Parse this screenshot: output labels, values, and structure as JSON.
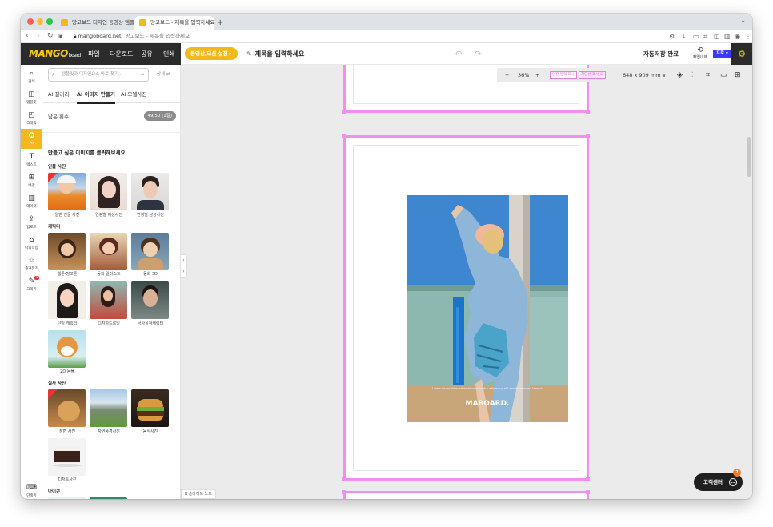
{
  "browser": {
    "tabs": [
      {
        "title": "망고보드 디자인 동영상 템플릿"
      },
      {
        "title": "망고보드 - 제목을 입력하세요"
      }
    ],
    "url": "mangoboard.net",
    "page_title": "망고보드 - 제목을 입력하세요"
  },
  "header": {
    "menu": [
      "파일",
      "다운로드",
      "공유",
      "인쇄"
    ],
    "mode_button": "동영상/모션 설정 ▸",
    "title_placeholder": "제목을 입력하세요",
    "autosave": "자동저장 완료",
    "history_label": "작업내역",
    "pro_label": "프로 ▾"
  },
  "rail": {
    "items": [
      {
        "label": "검색",
        "icon": "search-icon"
      },
      {
        "label": "템플릿",
        "icon": "template-icon"
      },
      {
        "label": "그래픽",
        "icon": "graphic-icon"
      },
      {
        "label": "AI",
        "icon": "ai-icon"
      },
      {
        "label": "텍스트",
        "icon": "text-icon"
      },
      {
        "label": "배경",
        "icon": "background-icon"
      },
      {
        "label": "데이터",
        "icon": "chart-icon"
      },
      {
        "label": "업로드",
        "icon": "upload-icon"
      },
      {
        "label": "나의작업",
        "icon": "folder-icon"
      },
      {
        "label": "즐겨찾기",
        "icon": "star-icon"
      },
      {
        "label": "그리기",
        "icon": "draw-icon"
      }
    ],
    "new_badge": "N",
    "shortcut_label": "단축키"
  },
  "panel": {
    "search_placeholder": "템플릿과 디자인요소 바로 찾기...",
    "detail_link": "상세 ⇄",
    "tabs": [
      "AI 갤러리",
      "AI 이미지 만들기",
      "AI 모델사진"
    ],
    "remain_label": "남은 횟수",
    "remain_value": "49/50 (1일)",
    "prompt": "만들고 싶은 이미지를 클릭해보세요.",
    "sections": {
      "people": {
        "title": "인물 사진",
        "items": [
          "일반 인물 사진",
          "연령별 여성사진",
          "연령별 남성사진"
        ]
      },
      "character": {
        "title": "캐릭터",
        "items": [
          "웹툰-망고툰",
          "동화 일러스트",
          "동화 3D",
          "단일 캐릭터",
          "디지털드로잉",
          "극사실적캐릭터",
          "2D 동물"
        ]
      },
      "real": {
        "title": "실사 사진",
        "items": [
          "장면 사진",
          "자연풍경사진",
          "음식사진",
          "디저트사진"
        ]
      },
      "icon": {
        "title": "아이콘"
      }
    }
  },
  "canvas": {
    "zoom_minus": "−",
    "zoom_value": "36%",
    "zoom_plus": "+",
    "safe_area": "안전 영역 표시",
    "print_line": "재단선 표시",
    "page_size": "648 x 909 mm ∨",
    "photo_caption_small": "Lorem ipsum dolor sit amet consectetur adipiscing elit sed do eiusmod tempor",
    "photo_brand": "MABOARD.",
    "slide_note": "슬라이드 노트",
    "support": "고객센터",
    "support_badge": "7"
  }
}
